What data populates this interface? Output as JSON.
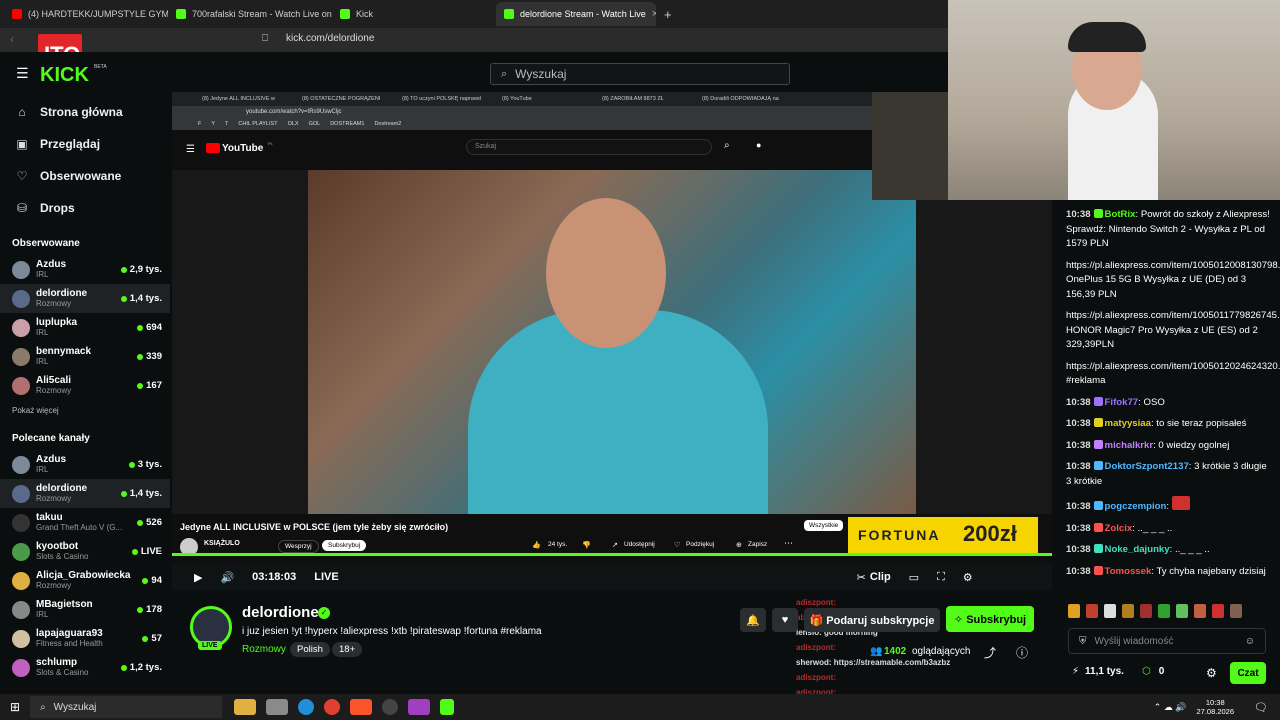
{
  "browser": {
    "tabs": [
      {
        "title": "(4) HARDTEKK/JUMPSTYLE GYM PLA",
        "color": "#ff0000"
      },
      {
        "title": "700rafalski Stream - Watch Live on K",
        "color": "#53fc18"
      },
      {
        "title": "Kick",
        "color": "#53fc18"
      },
      {
        "title": "delordione Stream - Watch Live",
        "color": "#53fc18",
        "active": true
      }
    ],
    "new_tab": "+",
    "url": "kick.com/delordione"
  },
  "kick": {
    "logo": "KICK",
    "logo_beta": "BETA",
    "search_placeholder": "Wyszukaj",
    "nav": [
      {
        "label": "Strona główna",
        "icon": "home-icon"
      },
      {
        "label": "Przeglądaj",
        "icon": "browse-icon"
      },
      {
        "label": "Obserwowane",
        "icon": "heart-icon"
      },
      {
        "label": "Drops",
        "icon": "drops-icon"
      }
    ],
    "followed_title": "Obserwowane",
    "followed": [
      {
        "name": "Azdus",
        "cat": "IRL",
        "viewers": "2,9 tys.",
        "color": "#7a8a99"
      },
      {
        "name": "delordione",
        "cat": "Rozmowy",
        "viewers": "1,4 tys.",
        "color": "#5a6a8a",
        "selected": true
      },
      {
        "name": "luplupka",
        "cat": "IRL",
        "viewers": "694",
        "color": "#c9a0a8"
      },
      {
        "name": "bennymack",
        "cat": "IRL",
        "viewers": "339",
        "color": "#8a7a6a"
      },
      {
        "name": "Ali5cali",
        "cat": "Rozmowy",
        "viewers": "167",
        "color": "#b07070"
      }
    ],
    "show_more": "Pokaż więcej",
    "recommended_title": "Polecane kanały",
    "recommended": [
      {
        "name": "Azdus",
        "cat": "IRL",
        "viewers": "3 tys.",
        "color": "#7a8a99"
      },
      {
        "name": "delordione",
        "cat": "Rozmowy",
        "viewers": "1,4 tys.",
        "color": "#5a6a8a",
        "selected": true
      },
      {
        "name": "takuu",
        "cat": "Grand Theft Auto V (G...",
        "viewers": "526",
        "color": "#333"
      },
      {
        "name": "kyootbot",
        "cat": "Slots & Casino",
        "viewers": "LIVE",
        "color": "#4a9a4a"
      },
      {
        "name": "Alicja_Grabowiecka",
        "cat": "Rozmowy",
        "viewers": "94",
        "color": "#e0b040"
      },
      {
        "name": "MBagietson",
        "cat": "IRL",
        "viewers": "178",
        "color": "#888"
      },
      {
        "name": "lapajaguara93",
        "cat": "Fitness and Health",
        "viewers": "57",
        "color": "#d0c0a0"
      },
      {
        "name": "schlump",
        "cat": "Slots & Casino",
        "viewers": "1,2 tys.",
        "color": "#c060c0"
      }
    ]
  },
  "youtube": {
    "tabs": [
      "(8) Jedyne ALL INCLUSIVE w",
      "(8) OSTATECZNE POGRĄŻENI",
      "(8) TO uczyni POLSKĘ naprawd",
      "(8) YouTube",
      "(8) ZAROBIŁAM 8873 ZŁ",
      "(8) Doradili ODPOWIADAJĄ na"
    ],
    "url": "youtube.com/watch?v=tRs9UswCljc",
    "bookmarks": [
      "F",
      "Y",
      "T",
      "CHIL PLAYLIST",
      "OLX",
      "GOL",
      "DOSTREAM1",
      "Dostream2"
    ],
    "logo": "YouTube",
    "logo_sup": "PL",
    "search_placeholder": "Szukaj",
    "video_title": "Jedyne ALL INCLUSIVE w POLSCE (jem tyle żeby się zwróciło)",
    "channel": "KSIĄŻULO",
    "support": "Wesprzyj",
    "subscribe": "Subskrybuj",
    "likes": "24 tys.",
    "share": "Udostępnij",
    "thanks": "Podziękuj",
    "save": "Zapisz",
    "all_chip": "Wszystkie",
    "ad_brand": "FORTUNA",
    "ad_amount": "200zł"
  },
  "player": {
    "time": "03:18:03",
    "live": "LIVE",
    "clip": "Clip"
  },
  "stream": {
    "streamer": "delordione",
    "title": "i juz jesien !yt !hyperx !aliexpress !xtb !pirateswap !fortuna #reklama",
    "category": "Rozmowy",
    "tags": [
      "Polish",
      "18+"
    ],
    "live_badge": "LIVE",
    "gift_label": "Podaruj subskrypcje",
    "subscribe_label": "Subskrybuj",
    "viewers": "1402",
    "viewers_label": "oglądających",
    "overlay_lines": [
      "adiszpont:",
      "abcazs",
      "lensio: good morning",
      "adiszpont:",
      "sherwod: https://streamable.com/b3azbz",
      "adiszpont:",
      "adiszpont:",
      "adiszpont:"
    ]
  },
  "chat": {
    "messages": [
      {
        "time": "10:38",
        "user": "BotRix",
        "color": "#53fc18",
        "text": "Powrót do szkoły z Aliexpress! Sprawdź: Nintendo Switch 2 - Wysyłka z PL od 1579 PLN"
      },
      {
        "time": "",
        "user": "",
        "color": "#fff",
        "text": "https://pl.aliexpress.com/item/1005012008130798.html OnePlus 15 5G B Wysyłka z UE (DE) od 3 156,39 PLN"
      },
      {
        "time": "",
        "user": "",
        "color": "#fff",
        "text": "https://pl.aliexpress.com/item/1005011779826745.html HONOR Magic7 Pro Wysyłka z UE (ES) od 2 329,39PLN"
      },
      {
        "time": "",
        "user": "",
        "color": "#fff",
        "text": "https://pl.aliexpress.com/item/1005012024624320.html #reklama"
      },
      {
        "time": "10:38",
        "user": "Fifok77",
        "color": "#a070ff",
        "text": "OSO"
      },
      {
        "time": "10:38",
        "user": "matyysiaa",
        "color": "#e0d020",
        "text": "to sie teraz popisałeś"
      },
      {
        "time": "10:38",
        "user": "michalkrkr",
        "color": "#c080ff",
        "text": "0 wiedzy ogolnej"
      },
      {
        "time": "10:38",
        "user": "DoktorSzpont2137",
        "color": "#4db8ff",
        "text": "3 krótkie 3 długie 3 krótkie"
      },
      {
        "time": "10:38",
        "user": "pogczempion",
        "color": "#4db8ff",
        "text": ""
      },
      {
        "time": "10:38",
        "user": "Zolcix",
        "color": "#ff5050",
        "text": ".._ _ _ .."
      },
      {
        "time": "10:38",
        "user": "Noke_dajunky",
        "color": "#40e0c0",
        "text": ".._ _ _ .."
      },
      {
        "time": "10:38",
        "user": "Tomossek",
        "color": "#ff5050",
        "text": "Ty chyba najebany dzisiaj"
      }
    ],
    "input_placeholder": "Wyślij wiadomość",
    "points": "11,1 tys.",
    "coins": "0",
    "chat_button": "Czat"
  },
  "taskbar": {
    "search": "Wyszukaj",
    "time": "10:38",
    "date": "27.08.2026"
  }
}
